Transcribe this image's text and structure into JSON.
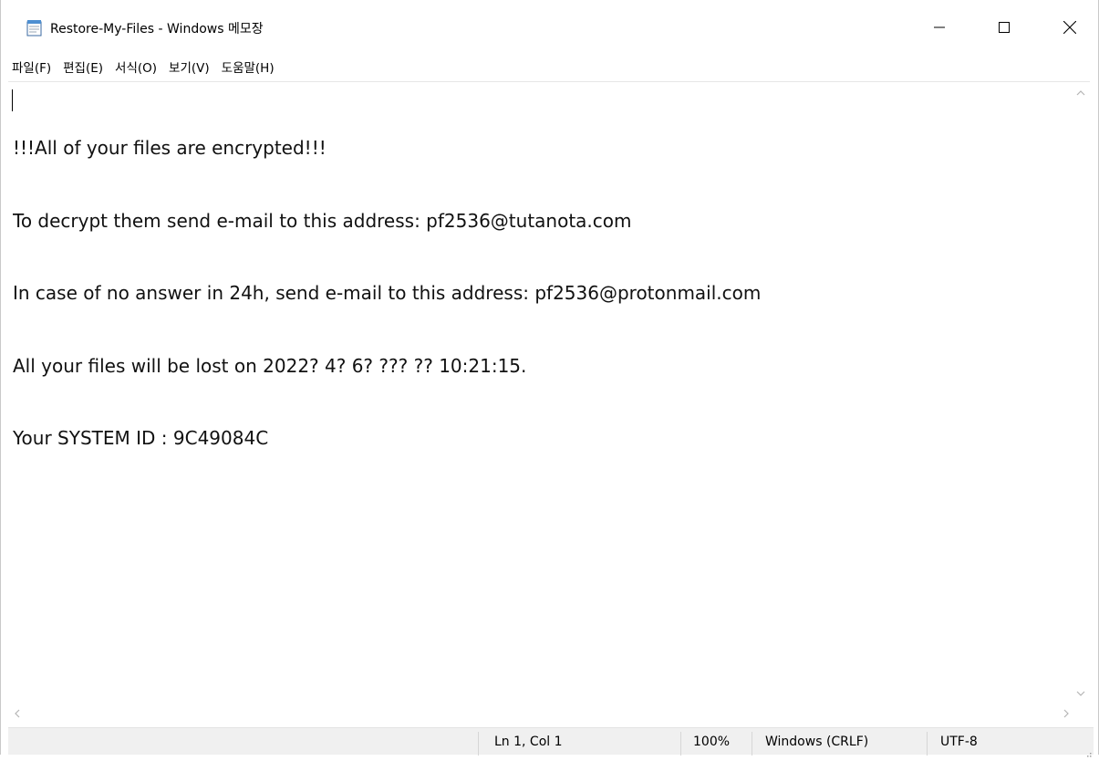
{
  "window": {
    "title": "Restore-My-Files - Windows 메모장",
    "app_icon": "notepad-icon",
    "controls": {
      "minimize_icon": "minimize-icon",
      "maximize_icon": "maximize-icon",
      "close_icon": "close-icon"
    }
  },
  "menu": [
    {
      "label": "파일(F)"
    },
    {
      "label": "편집(E)"
    },
    {
      "label": "서식(O)"
    },
    {
      "label": "보기(V)"
    },
    {
      "label": "도움말(H)"
    }
  ],
  "document": {
    "lines": [
      "!!!All of your files are encrypted!!!",
      "To decrypt them send e-mail to this address: pf2536@tutanota.com",
      "In case of no answer in 24h, send e-mail to this address: pf2536@protonmail.com",
      "All your files will be lost on 2022? 4? 6? ??? ?? 10:21:15.",
      "Your SYSTEM ID : 9C49084C"
    ]
  },
  "statusbar": {
    "position": "Ln 1, Col 1",
    "zoom": "100%",
    "line_ending": "Windows (CRLF)",
    "encoding": "UTF-8"
  },
  "colors": {
    "statusbar_bg": "#f0f0f0",
    "text": "#111111"
  }
}
